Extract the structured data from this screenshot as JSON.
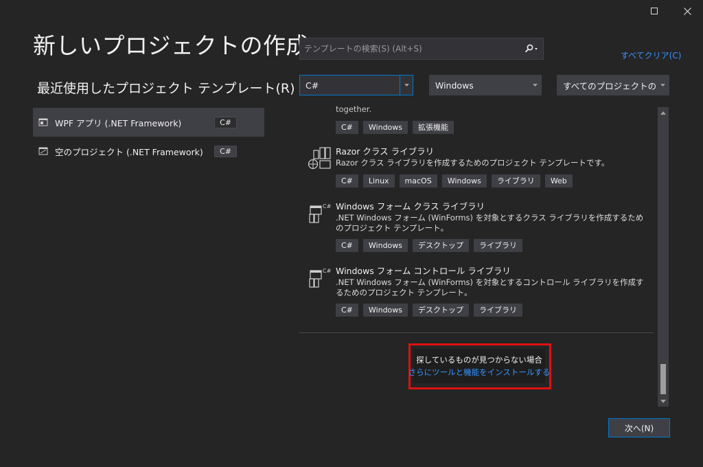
{
  "window": {
    "maximize_icon": "maximize-icon",
    "close_icon": "close-icon"
  },
  "header": {
    "title": "新しいプロジェクトの作成",
    "recent_heading": "最近使用したプロジェクト テンプレート",
    "recent_heading_key": "(R)"
  },
  "recent": [
    {
      "label": "WPF アプリ (.NET Framework)",
      "lang": "C#",
      "selected": true
    },
    {
      "label": "空のプロジェクト (.NET Framework)",
      "lang": "C#",
      "selected": false
    }
  ],
  "search": {
    "placeholder": "テンプレートの検索(S) (Alt+S)",
    "clear_all": "すべてクリア(C)"
  },
  "filters": {
    "language": "C#",
    "platform": "Windows",
    "project_type": "すべてのプロジェクトの種類..."
  },
  "templates": [
    {
      "name": "",
      "desc": "together.",
      "tags": [
        "C#",
        "Windows",
        "拡張機能"
      ]
    },
    {
      "name": "Razor クラス ライブラリ",
      "desc": "Razor クラス ライブラリを作成するためのプロジェクト テンプレートです。",
      "tags": [
        "C#",
        "Linux",
        "macOS",
        "Windows",
        "ライブラリ",
        "Web"
      ]
    },
    {
      "name": "Windows フォーム クラス ライブラリ",
      "desc": ".NET Windows フォーム (WinForms) を対象とするクラス ライブラリを作成するためのプロジェクト テンプレート。",
      "tags": [
        "C#",
        "Windows",
        "デスクトップ",
        "ライブラリ"
      ]
    },
    {
      "name": "Windows フォーム コントロール ライブラリ",
      "desc": ".NET Windows フォーム (WinForms) を対象とするコントロール ライブラリを作成するためのプロジェクト テンプレート。",
      "tags": [
        "C#",
        "Windows",
        "デスクトップ",
        "ライブラリ"
      ]
    }
  ],
  "notfound": {
    "text": "探しているものが見つからない場合",
    "link": "さらにツールと機能をインストールする"
  },
  "footer": {
    "next": "次へ(N)"
  },
  "colors": {
    "background": "#252526",
    "accent": "#007acc",
    "link": "#3794ff",
    "highlight": "#e01010"
  }
}
